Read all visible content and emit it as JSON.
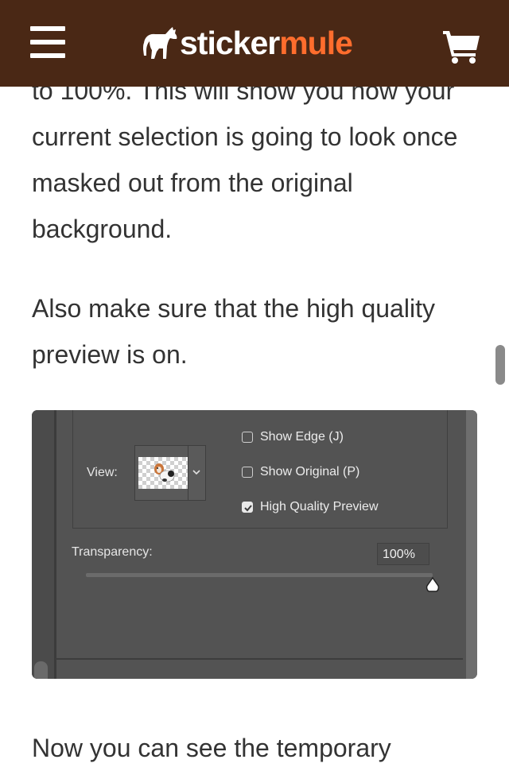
{
  "header": {
    "menu_icon": "hamburger-menu-icon",
    "logo_part1": "sticker",
    "logo_part2": "mule",
    "cart_icon": "shopping-cart-icon",
    "bg_color": "#4a2815",
    "brand_accent": "#ff6d2d"
  },
  "article": {
    "para1": "to 100%. This will show you how your current selection is going to look once masked out from the original background.",
    "para2": "Also make sure that the high quality preview is on.",
    "para3": "Now you can see the temporary"
  },
  "screenshot": {
    "view_label": "View:",
    "checkboxes": [
      {
        "label": "Show Edge (J)",
        "checked": false
      },
      {
        "label": "Show Original (P)",
        "checked": false
      },
      {
        "label": "High Quality Preview",
        "checked": true
      }
    ],
    "transparency_label": "Transparency:",
    "transparency_value": "100%",
    "transparency_fraction": 1.0
  }
}
